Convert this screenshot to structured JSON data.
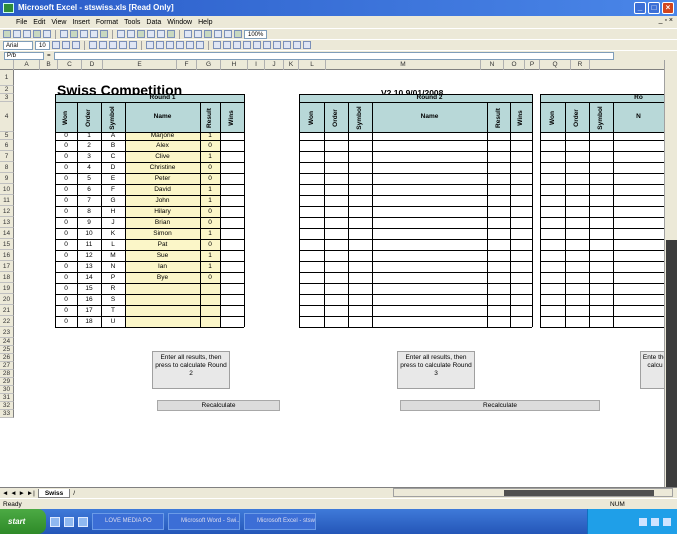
{
  "window": {
    "title": "Microsoft Excel - stswiss.xls [Read Only]",
    "buttons": [
      "_",
      "□",
      "×"
    ]
  },
  "menu": {
    "items": [
      "File",
      "Edit",
      "View",
      "Insert",
      "Format",
      "Tools",
      "Data",
      "Window",
      "Help"
    ],
    "doc_controls": "_ ▫ ×"
  },
  "toolbar": {
    "zoom": "100%",
    "font_name": "Arial",
    "font_size": "10"
  },
  "formula_bar": {
    "name_box": "P/b",
    "value": ""
  },
  "columns": [
    "A",
    "B",
    "C",
    "D",
    "E",
    "F",
    "G",
    "H",
    "I",
    "J",
    "K",
    "L",
    "M",
    "N",
    "O",
    "P",
    "Q",
    "R"
  ],
  "rows": [
    "1",
    "2",
    "3",
    "4",
    "5",
    "6",
    "7",
    "8",
    "9",
    "10",
    "11",
    "12",
    "13",
    "14",
    "15",
    "16",
    "17",
    "18",
    "19",
    "20",
    "21",
    "22",
    "23",
    "24",
    "25",
    "26",
    "27",
    "28",
    "29",
    "30",
    "31",
    "32",
    "33"
  ],
  "sheet": {
    "title": "Swiss Competition",
    "version": "V2.10   9/01/2008",
    "round1": {
      "header": "Round 1",
      "col_headers": [
        "Won",
        "Order",
        "Symbol",
        "Name",
        "Result",
        "Wins"
      ]
    },
    "round2": {
      "header": "Round 2",
      "col_headers": [
        "Won",
        "Order",
        "Symbol",
        "Name",
        "Result",
        "Wins"
      ]
    },
    "round3": {
      "header": "Ro",
      "col_headers": [
        "Won",
        "Order",
        "Symbol",
        "N"
      ]
    },
    "players": [
      {
        "won": "0",
        "order": "1",
        "symbol": "A",
        "name": "Marjorie",
        "result": "1"
      },
      {
        "won": "0",
        "order": "2",
        "symbol": "B",
        "name": "Alex",
        "result": "0"
      },
      {
        "won": "0",
        "order": "3",
        "symbol": "C",
        "name": "Clive",
        "result": "1"
      },
      {
        "won": "0",
        "order": "4",
        "symbol": "D",
        "name": "Christine",
        "result": "0"
      },
      {
        "won": "0",
        "order": "5",
        "symbol": "E",
        "name": "Peter",
        "result": "0"
      },
      {
        "won": "0",
        "order": "6",
        "symbol": "F",
        "name": "David",
        "result": "1"
      },
      {
        "won": "0",
        "order": "7",
        "symbol": "G",
        "name": "John",
        "result": "1"
      },
      {
        "won": "0",
        "order": "8",
        "symbol": "H",
        "name": "Hilary",
        "result": "0"
      },
      {
        "won": "0",
        "order": "9",
        "symbol": "J",
        "name": "Brian",
        "result": "0"
      },
      {
        "won": "0",
        "order": "10",
        "symbol": "K",
        "name": "Simon",
        "result": "1"
      },
      {
        "won": "0",
        "order": "11",
        "symbol": "L",
        "name": "Pat",
        "result": "0"
      },
      {
        "won": "0",
        "order": "12",
        "symbol": "M",
        "name": "Sue",
        "result": "1"
      },
      {
        "won": "0",
        "order": "13",
        "symbol": "N",
        "name": "Ian",
        "result": "1"
      },
      {
        "won": "0",
        "order": "14",
        "symbol": "P",
        "name": "Bye",
        "result": "0"
      },
      {
        "won": "0",
        "order": "15",
        "symbol": "R",
        "name": "",
        "result": ""
      },
      {
        "won": "0",
        "order": "16",
        "symbol": "S",
        "name": "",
        "result": ""
      },
      {
        "won": "0",
        "order": "17",
        "symbol": "T",
        "name": "",
        "result": ""
      },
      {
        "won": "0",
        "order": "18",
        "symbol": "U",
        "name": "",
        "result": ""
      }
    ],
    "button_round2": "Enter all results, then press to calculate Round 2",
    "button_round3": "Enter all results, then press to calculate Round 3",
    "button_round4": "Ente the calcu",
    "recalc_label": "Recalculate"
  },
  "sheet_tab": "Swiss",
  "status": {
    "left": "Ready",
    "num": "NUM"
  },
  "taskbar": {
    "start": "start",
    "tasks": [
      "LOVE MEDIA PO",
      "Microsoft Word - Swi...",
      "Microsoft Excel - stsw..."
    ]
  }
}
